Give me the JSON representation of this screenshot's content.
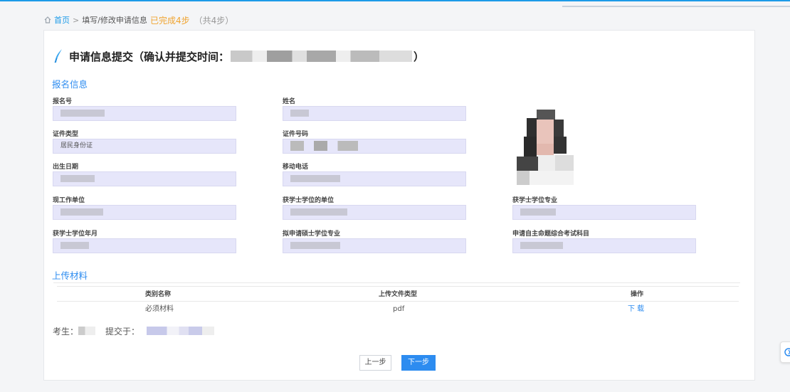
{
  "breadcrumb": {
    "home": "首页",
    "separator": ">",
    "current": "填写/修改申请信息",
    "progress": "已完成4步",
    "total": "（共4步）"
  },
  "title": {
    "text": "申请信息提交（确认并提交时间：",
    "suffix": "）"
  },
  "sections": {
    "registration": "报名信息",
    "upload": "上传材料"
  },
  "fields": [
    {
      "label": "报名号",
      "value": ""
    },
    {
      "label": "姓名",
      "value": ""
    },
    {
      "label": "证件类型",
      "value": "居民身份证"
    },
    {
      "label": "证件号码",
      "value": ""
    },
    {
      "label": "出生日期",
      "value": ""
    },
    {
      "label": "移动电话",
      "value": ""
    },
    {
      "label": "现工作单位",
      "value": ""
    },
    {
      "label": "获学士学位的单位",
      "value": ""
    },
    {
      "label": "获学士学位专业",
      "value": ""
    },
    {
      "label": "获学士学位年月",
      "value": ""
    },
    {
      "label": "拟申请硕士学位专业",
      "value": ""
    },
    {
      "label": "申请自主命题综合考试科目",
      "value": ""
    }
  ],
  "table": {
    "headers": [
      "类别名称",
      "上传文件类型",
      "操作"
    ],
    "rows": [
      {
        "category": "必须材料",
        "filetype": "pdf",
        "action": "下 载"
      }
    ]
  },
  "footer": {
    "examinee_label": "考生：",
    "submitted_label": "提交于："
  },
  "buttons": {
    "prev": "上一步",
    "next": "下一步"
  },
  "colors": {
    "accent": "#2d8cf0",
    "progress": "#f0a430",
    "field_bg": "#e6e6fa"
  },
  "icons": {
    "breadcrumb": "home-icon",
    "title": "pen-icon",
    "side": "refresh-icon"
  }
}
